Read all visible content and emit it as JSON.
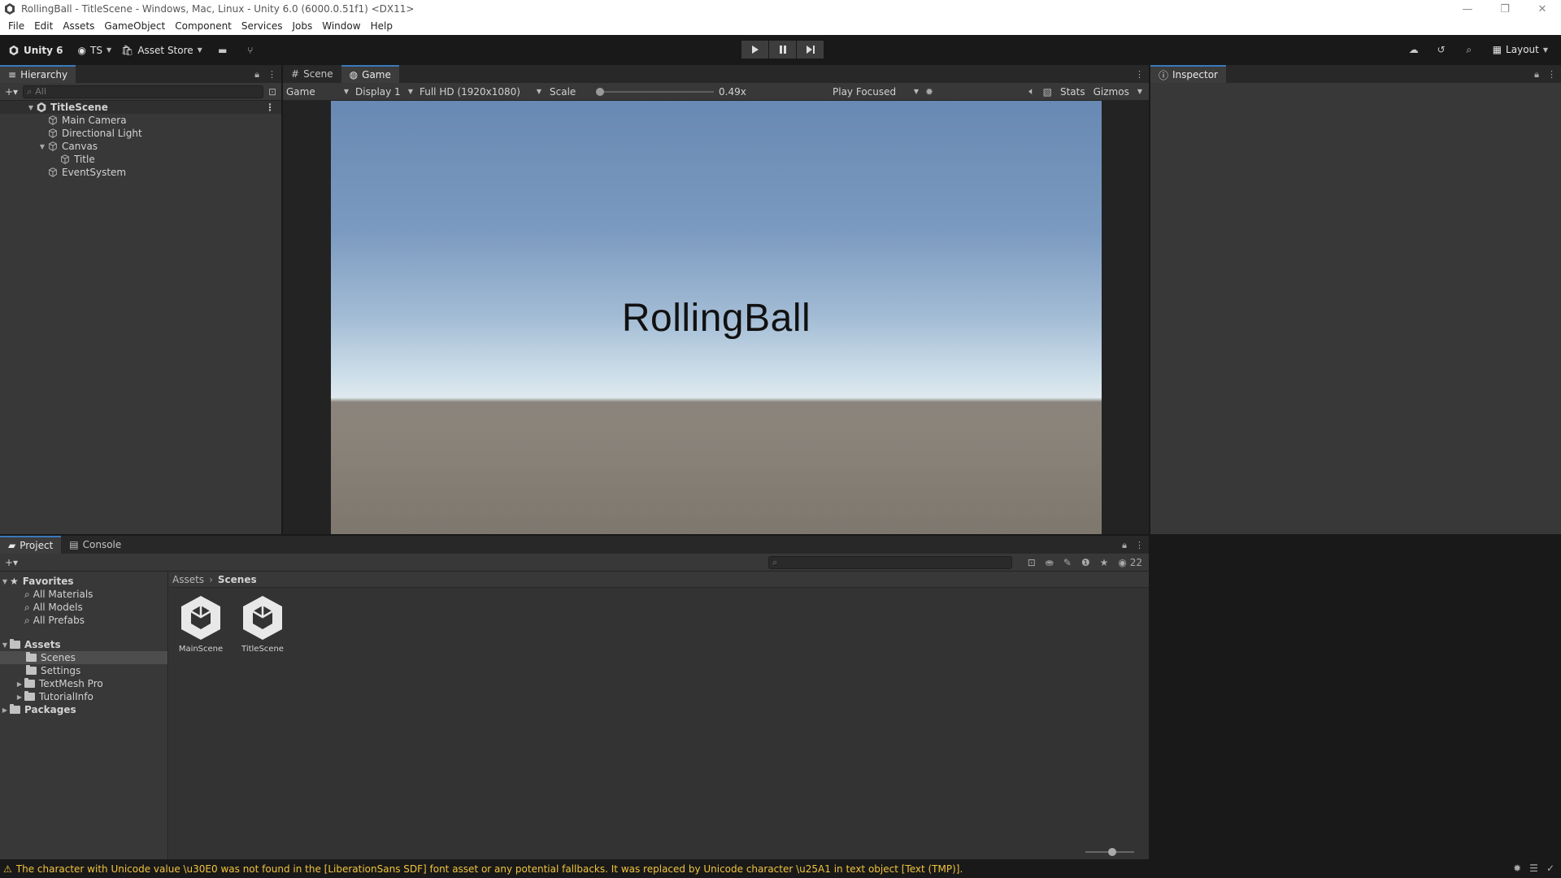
{
  "window": {
    "title": "RollingBall - TitleScene - Windows, Mac, Linux - Unity 6.0 (6000.0.51f1) <DX11>",
    "controls": [
      "—",
      "❐",
      "✕"
    ]
  },
  "menu": [
    "File",
    "Edit",
    "Assets",
    "GameObject",
    "Component",
    "Services",
    "Jobs",
    "Window",
    "Help"
  ],
  "toolbar": {
    "unity_label": "Unity 6",
    "account_label": "TS",
    "asset_store_label": "Asset Store",
    "layout_label": "Layout"
  },
  "hierarchy": {
    "tab_label": "Hierarchy",
    "search_placeholder": "All",
    "scene": "TitleScene",
    "items": [
      "Main Camera",
      "Directional Light",
      "Canvas",
      "Title",
      "EventSystem"
    ]
  },
  "scene_tab": {
    "label": "Scene"
  },
  "game": {
    "tab_label": "Game",
    "view_mode": "Game",
    "display": "Display 1",
    "resolution": "Full HD (1920x1080)",
    "scale_label": "Scale",
    "scale_value": "0.49x",
    "play_mode": "Play Focused",
    "stats_label": "Stats",
    "gizmos_label": "Gizmos",
    "title_text": "RollingBall"
  },
  "inspector": {
    "tab_label": "Inspector"
  },
  "project": {
    "tab_label": "Project",
    "console_tab_label": "Console",
    "favorites_label": "Favorites",
    "favorites": [
      "All Materials",
      "All Models",
      "All Prefabs"
    ],
    "assets_label": "Assets",
    "asset_folders": [
      "Scenes",
      "Settings",
      "TextMesh Pro",
      "TutorialInfo"
    ],
    "packages_label": "Packages",
    "breadcrumb": [
      "Assets",
      "Scenes"
    ],
    "files": [
      "MainScene",
      "TitleScene"
    ],
    "hidden_count": "22"
  },
  "status": {
    "message": "The character with Unicode value \\u30E0 was not found in the [LiberationSans SDF] font asset or any potential fallbacks. It was replaced by Unicode character \\u25A1 in text object [Text (TMP)]."
  }
}
